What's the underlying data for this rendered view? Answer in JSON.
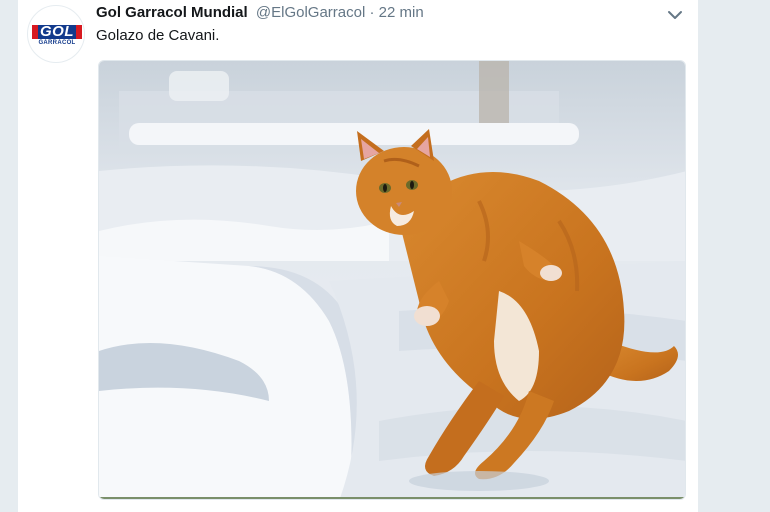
{
  "tweet": {
    "display_name": "Gol Garracol Mundial",
    "handle": "@ElGolGarracol",
    "separator": "·",
    "time": "22 min",
    "text": "Golazo de Cavani."
  },
  "avatar": {
    "logo_text": "GOL",
    "logo_subtext": "GARRACOL"
  },
  "colors": {
    "background": "#e6ecf0",
    "card": "#ffffff",
    "name": "#14171a",
    "secondary": "#657786",
    "logo_blue": "#123a8c",
    "logo_red": "#d71920"
  },
  "icons": {
    "menu": "chevron-down-icon"
  }
}
